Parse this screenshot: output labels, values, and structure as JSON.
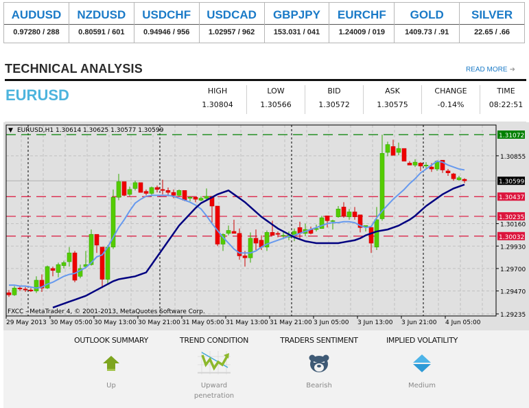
{
  "ticker": [
    {
      "symbol": "AUDUSD",
      "quote": "0.97280 / 288"
    },
    {
      "symbol": "NZDUSD",
      "quote": "0.80591 / 601"
    },
    {
      "symbol": "USDCHF",
      "quote": "0.94946 / 956"
    },
    {
      "symbol": "USDCAD",
      "quote": "1.02957 / 962"
    },
    {
      "symbol": "GBPJPY",
      "quote": "153.031 / 041"
    },
    {
      "symbol": "EURCHF",
      "quote": "1.24009 / 019"
    },
    {
      "symbol": "GOLD",
      "quote": "1409.73 / .91"
    },
    {
      "symbol": "SILVER",
      "quote": "22.65 / .66"
    }
  ],
  "section": {
    "title": "TECHNICAL ANALYSIS",
    "read_more": "READ MORE",
    "read_more_icon": "arrow-right-icon"
  },
  "pair": "EURUSD",
  "stats": [
    {
      "label": "HIGH",
      "value": "1.30804"
    },
    {
      "label": "LOW",
      "value": "1.30566"
    },
    {
      "label": "BID",
      "value": "1.30572"
    },
    {
      "label": "ASK",
      "value": "1.30575"
    },
    {
      "label": "CHANGE",
      "value": "-0.14%"
    },
    {
      "label": "TIME",
      "value": "08:22:51"
    }
  ],
  "colors": {
    "accent": "#1a7ac7",
    "pair": "#4db4dd",
    "bull": "#55cc00",
    "bear": "#ee0000",
    "ma_fast": "#6699ee",
    "ma_slow": "#000080",
    "level_red": "#dc143c",
    "level_green": "#008000"
  },
  "chart_data": {
    "type": "candlestick",
    "header": "EURUSD,H1  1.30614 1.30625 1.30577 1.30599",
    "copyright": "FXCC - MetaTrader 4, © 2001-2013, MetaQuotes Software Corp.",
    "ylim": [
      1.292,
      1.3118
    ],
    "y_ticks": [
      "1.30855",
      "1.30160",
      "1.29930",
      "1.29700",
      "1.29470",
      "1.29235"
    ],
    "x_ticks": [
      "29 May 2013",
      "30 May 05:00",
      "30 May 13:00",
      "30 May 21:00",
      "31 May 05:00",
      "31 May 13:00",
      "31 May 21:00",
      "3 Jun 05:00",
      "3 Jun 13:00",
      "3 Jun 21:00",
      "4 Jun 05:00"
    ],
    "x_tick_index": [
      0,
      8,
      16,
      24,
      32,
      40,
      48,
      56,
      64,
      72,
      80
    ],
    "day_separators": [
      3,
      27,
      51,
      75
    ],
    "current_price": "1.30599",
    "levels": [
      {
        "price": 1.31072,
        "label": "1.31072",
        "color": "green"
      },
      {
        "price": 1.30437,
        "label": "1.30437",
        "color": "red"
      },
      {
        "price": 1.30235,
        "label": "1.30235",
        "color": "red"
      },
      {
        "price": 1.30032,
        "label": "1.30032",
        "color": "red"
      }
    ],
    "candles": [
      [
        1.29452,
        1.2948,
        1.2941,
        1.2943
      ],
      [
        1.2943,
        1.2952,
        1.2942,
        1.295
      ],
      [
        1.295,
        1.2952,
        1.2947,
        1.2949
      ],
      [
        1.2949,
        1.2951,
        1.2946,
        1.2948
      ],
      [
        1.2948,
        1.295,
        1.2946,
        1.2947
      ],
      [
        1.2947,
        1.2962,
        1.2945,
        1.2958
      ],
      [
        1.2958,
        1.2964,
        1.2946,
        1.295
      ],
      [
        1.295,
        1.2973,
        1.2949,
        1.2972
      ],
      [
        1.297,
        1.2972,
        1.2962,
        1.2968
      ],
      [
        1.2966,
        1.2976,
        1.2961,
        1.2974
      ],
      [
        1.2973,
        1.2978,
        1.297,
        1.2976
      ],
      [
        1.2977,
        1.2992,
        1.2972,
        1.2986
      ],
      [
        1.2986,
        1.2988,
        1.2956,
        1.2958
      ],
      [
        1.2962,
        1.2974,
        1.296,
        1.297
      ],
      [
        1.2972,
        1.2988,
        1.297,
        1.2974
      ],
      [
        1.2974,
        1.301,
        1.2973,
        1.3005
      ],
      [
        1.3005,
        1.3005,
        1.2986,
        1.2994
      ],
      [
        1.2992,
        1.2992,
        1.295,
        1.2959
      ],
      [
        1.2959,
        1.2994,
        1.2954,
        1.2992
      ],
      [
        1.2992,
        1.3051,
        1.299,
        1.3043
      ],
      [
        1.3043,
        1.3067,
        1.304,
        1.3059
      ],
      [
        1.3059,
        1.3059,
        1.3044,
        1.3045
      ],
      [
        1.3046,
        1.3054,
        1.3044,
        1.3051
      ],
      [
        1.3052,
        1.306,
        1.305,
        1.3058
      ],
      [
        1.3058,
        1.3058,
        1.3048,
        1.3048
      ],
      [
        1.3049,
        1.3051,
        1.3045,
        1.3047
      ],
      [
        1.3047,
        1.3054,
        1.3044,
        1.3053
      ],
      [
        1.3053,
        1.3055,
        1.3048,
        1.3051
      ],
      [
        1.3051,
        1.3061,
        1.3046,
        1.305
      ],
      [
        1.305,
        1.3053,
        1.3044,
        1.3048
      ],
      [
        1.3048,
        1.3051,
        1.3042,
        1.3045
      ],
      [
        1.3045,
        1.3051,
        1.3044,
        1.305
      ],
      [
        1.305,
        1.305,
        1.3039,
        1.304
      ],
      [
        1.3042,
        1.3044,
        1.3039,
        1.3043
      ],
      [
        1.3043,
        1.3043,
        1.3038,
        1.3041
      ],
      [
        1.304,
        1.3044,
        1.3039,
        1.3042
      ],
      [
        1.3042,
        1.3052,
        1.3039,
        1.3044
      ],
      [
        1.3044,
        1.3044,
        1.3017,
        1.3034
      ],
      [
        1.3034,
        1.3034,
        1.2993,
        1.2995
      ],
      [
        1.2995,
        1.3006,
        1.2988,
        1.3005
      ],
      [
        1.3006,
        1.3014,
        1.3004,
        1.3009
      ],
      [
        1.3008,
        1.302,
        1.3007,
        1.3006
      ],
      [
        1.3006,
        1.3011,
        1.2979,
        1.2983
      ],
      [
        1.2983,
        1.2988,
        1.2972,
        1.2981
      ],
      [
        1.2981,
        1.3007,
        1.2976,
        1.3001
      ],
      [
        1.3001,
        1.301,
        1.2989,
        1.2996
      ],
      [
        1.2999,
        1.3004,
        1.2989,
        1.2992
      ],
      [
        1.2992,
        1.3009,
        1.2988,
        1.3007
      ],
      [
        1.3007,
        1.3019,
        1.3005,
        1.3004
      ],
      [
        1.3006,
        1.3008,
        1.3002,
        1.3005
      ],
      [
        1.3004,
        1.3008,
        1.3,
        1.3004
      ],
      [
        1.3002,
        1.3008,
        1.2999,
        1.3004
      ],
      [
        1.3004,
        1.3011,
        1.2998,
        1.3008
      ],
      [
        1.3012,
        1.3018,
        1.3,
        1.3006
      ],
      [
        1.3006,
        1.3016,
        1.3003,
        1.301
      ],
      [
        1.301,
        1.3013,
        1.3005,
        1.3006
      ],
      [
        1.301,
        1.3015,
        1.3008,
        1.3011
      ],
      [
        1.3011,
        1.3024,
        1.3011,
        1.3022
      ],
      [
        1.3024,
        1.3022,
        1.3012,
        1.3019
      ],
      [
        1.3019,
        1.302,
        1.301,
        1.3019
      ],
      [
        1.3023,
        1.3034,
        1.3022,
        1.3031
      ],
      [
        1.3033,
        1.3038,
        1.3022,
        1.3024
      ],
      [
        1.3023,
        1.3031,
        1.302,
        1.3028
      ],
      [
        1.3028,
        1.3033,
        1.302,
        1.3023
      ],
      [
        1.3025,
        1.3025,
        1.3007,
        1.3012
      ],
      [
        1.3013,
        1.3013,
        1.3008,
        1.3014
      ],
      [
        1.3012,
        1.3012,
        1.2986,
        1.2996
      ],
      [
        1.2992,
        1.3033,
        1.2989,
        1.302
      ],
      [
        1.3021,
        1.31072,
        1.3019,
        1.3088
      ],
      [
        1.3089,
        1.31,
        1.3085,
        1.3097
      ],
      [
        1.3095,
        1.3102,
        1.3088,
        1.3086
      ],
      [
        1.3089,
        1.3099,
        1.3086,
        1.3093
      ],
      [
        1.3093,
        1.3093,
        1.308,
        1.308
      ],
      [
        1.3078,
        1.308,
        1.3076,
        1.3076
      ],
      [
        1.3076,
        1.3082,
        1.3074,
        1.3079
      ],
      [
        1.3078,
        1.3079,
        1.307,
        1.3075
      ],
      [
        1.3075,
        1.3079,
        1.3072,
        1.3076
      ],
      [
        1.3074,
        1.3078,
        1.3069,
        1.3072
      ],
      [
        1.3072,
        1.3081,
        1.307,
        1.308
      ],
      [
        1.3081,
        1.3081,
        1.3068,
        1.3071
      ],
      [
        1.307,
        1.3072,
        1.3065,
        1.3068
      ],
      [
        1.3067,
        1.3068,
        1.306,
        1.3062
      ],
      [
        1.3061,
        1.3065,
        1.306,
        1.3063
      ],
      [
        1.30614,
        1.30625,
        1.30577,
        1.30599
      ]
    ],
    "ma_fast": [
      1.2953,
      1.2953,
      1.2952,
      1.2952,
      1.2951,
      1.295,
      1.2951,
      1.2954,
      1.2956,
      1.2959,
      1.2962,
      1.2964,
      1.2965,
      1.2968,
      1.2971,
      1.2976,
      1.2982,
      1.2984,
      1.2992,
      1.3002,
      1.3012,
      1.302,
      1.3029,
      1.3037,
      1.3041,
      1.3044,
      1.3045,
      1.3045,
      1.3045,
      1.3045,
      1.3044,
      1.3042,
      1.304,
      1.3038,
      1.3035,
      1.3031,
      1.3024,
      1.3016,
      1.3009,
      1.3002,
      1.2996,
      1.299,
      1.2986,
      1.2986,
      1.2986,
      1.2988,
      1.2992,
      1.2995,
      1.2997,
      1.2999,
      1.3001,
      1.3003,
      1.3004,
      1.3006,
      1.3008,
      1.301,
      1.3012,
      1.3014,
      1.3016,
      1.3017,
      1.3017,
      1.3018,
      1.3018,
      1.3017,
      1.3014,
      1.3012,
      1.3013,
      1.3022,
      1.3029,
      1.3035,
      1.3041,
      1.3046,
      1.3051,
      1.3057,
      1.3062,
      1.3068,
      1.3072,
      1.3076,
      1.308,
      1.3079,
      1.3076,
      1.3074,
      1.3072,
      1.3071
    ],
    "ma_slow": [
      1.293,
      1.2932,
      1.2934,
      1.2936,
      1.2938,
      1.294,
      1.2942,
      1.2945,
      1.2948,
      1.2951,
      1.2954,
      1.2957,
      1.2959,
      1.296,
      1.2961,
      1.2962,
      1.2964,
      1.2966,
      1.2974,
      1.2982,
      1.299,
      1.2998,
      1.3006,
      1.3014,
      1.302,
      1.3026,
      1.3032,
      1.3037,
      1.304,
      1.3043,
      1.3046,
      1.3048,
      1.305,
      1.3046,
      1.3042,
      1.3038,
      1.3033,
      1.3028,
      1.3023,
      1.3019,
      1.3015,
      1.3011,
      1.3008,
      1.3005,
      1.3002,
      1.3,
      1.2998,
      1.2997,
      1.2996,
      1.2996,
      1.2996,
      1.2996,
      1.2996,
      1.2997,
      1.2998,
      1.2999,
      1.3001,
      1.3004,
      1.3006,
      1.3008,
      1.3009,
      1.301,
      1.3012,
      1.3014,
      1.3017,
      1.302,
      1.3024,
      1.3029,
      1.3034,
      1.3038,
      1.3042,
      1.3046,
      1.3049,
      1.3052,
      1.3054,
      1.3056
    ]
  },
  "indicators": [
    {
      "label": "OUTLOOK SUMMARY",
      "value": "Up",
      "icon": "arrow-up-icon"
    },
    {
      "label": "TREND CONDITION",
      "value": "Upward penetration",
      "icon": "trend-chart-icon"
    },
    {
      "label": "TRADERS SENTIMENT",
      "value": "Bearish",
      "icon": "bear-icon"
    },
    {
      "label": "IMPLIED VOLATILITY",
      "value": "Medium",
      "icon": "diamond-icon"
    }
  ]
}
